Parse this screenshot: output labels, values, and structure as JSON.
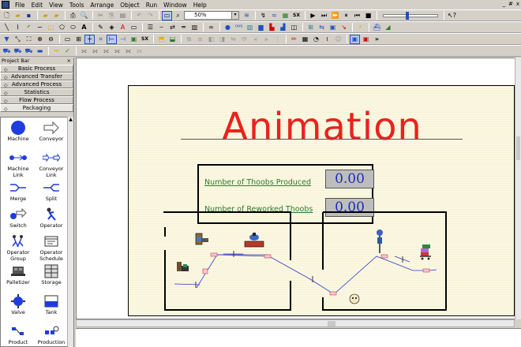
{
  "menubar": {
    "items": [
      "File",
      "Edit",
      "View",
      "Tools",
      "Arrange",
      "Object",
      "Run",
      "Window",
      "Help"
    ],
    "window_controls": [
      "_",
      "#",
      "x"
    ]
  },
  "toolbar": {
    "zoom_value": "50%",
    "speed_label": "SX"
  },
  "project_bar": {
    "title": "Project Bar",
    "close": "×",
    "categories": [
      "Basic Process",
      "Advanced Transfer",
      "Advanced Process",
      "Statistics",
      "Flow Process",
      "Packaging"
    ],
    "selected_category": "Packaging",
    "modules": [
      {
        "label": "Machine",
        "icon": "machine-icon"
      },
      {
        "label": "Conveyor",
        "icon": "conveyor-icon"
      },
      {
        "label": "Machine Link",
        "icon": "machine-link-icon"
      },
      {
        "label": "Conveyor Link",
        "icon": "conveyor-link-icon"
      },
      {
        "label": "Merge",
        "icon": "merge-icon"
      },
      {
        "label": "Split",
        "icon": "split-icon"
      },
      {
        "label": "Switch",
        "icon": "switch-icon"
      },
      {
        "label": "Operator",
        "icon": "operator-icon"
      },
      {
        "label": "Operator Group",
        "icon": "operator-group-icon"
      },
      {
        "label": "Operator Schedule",
        "icon": "operator-schedule-icon"
      },
      {
        "label": "Palletizer",
        "icon": "palletizer-icon"
      },
      {
        "label": "Storage",
        "icon": "storage-icon"
      },
      {
        "label": "Valve",
        "icon": "valve-icon"
      },
      {
        "label": "Tank",
        "icon": "tank-icon"
      },
      {
        "label": "Product",
        "icon": "product-icon"
      },
      {
        "label": "Production",
        "icon": "production-icon"
      }
    ]
  },
  "animation": {
    "title": "Animation",
    "counters": [
      {
        "label": "Number of Thoobs Produced",
        "value": "0.00"
      },
      {
        "label": "Number of Reworked Thoobs",
        "value": "0.00"
      }
    ]
  },
  "colors": {
    "title_red": "#e8231e",
    "label_green": "#2a7b2a",
    "value_blue": "#1e2db5",
    "sheet_bg": "#fbf8e2"
  }
}
